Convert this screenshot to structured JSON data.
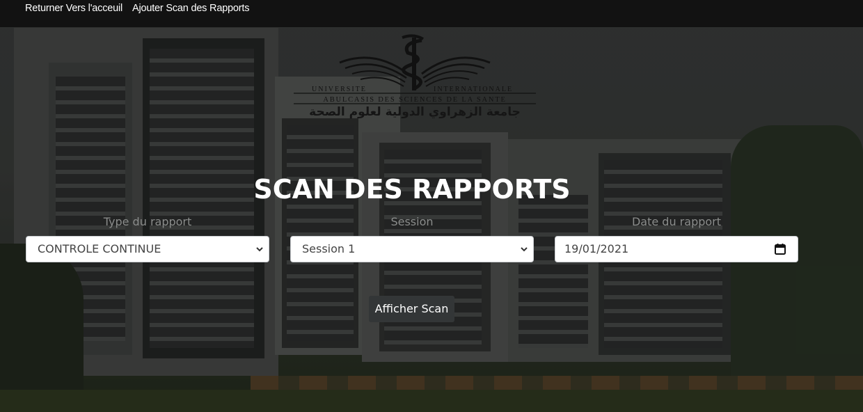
{
  "nav": {
    "home": "Returner Vers l'acceuil",
    "add_scan": "Ajouter Scan des Rapports"
  },
  "logo": {
    "line1_left": "UNIVERSITE",
    "line1_right": "INTERNATIONALE",
    "line2": "ABULCASIS DES SCIENCES DE LA SANTE",
    "arabic": "جامعة الزهراوي الدولية لعلوم الصحة"
  },
  "title": "SCAN DES RAPPORTS",
  "form": {
    "type_label": "Type du rapport",
    "type_value": "CONTROLE CONTINUE",
    "session_label": "Session",
    "session_value": "Session 1",
    "date_label": "Date du rapport",
    "date_value": "19/01/2021",
    "submit_label": "Afficher Scan"
  },
  "icons": {
    "type_select": "chevron-down-icon",
    "session_select": "chevron-down-icon",
    "date_picker": "calendar-icon"
  },
  "colors": {
    "navbar": "#121212",
    "button": "#333637",
    "label": "#8a8c8b"
  }
}
